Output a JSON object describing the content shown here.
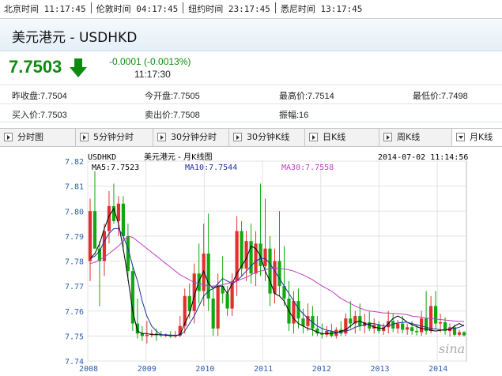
{
  "clocks": [
    {
      "label": "北京时间 11:17:45"
    },
    {
      "label": "伦敦时间 04:17:45"
    },
    {
      "label": "纽约时间 23:17:45"
    },
    {
      "label": "悉尼时间 13:17:45"
    }
  ],
  "header": {
    "title": "美元港元 - USDHKD"
  },
  "quote": {
    "price": "7.7503",
    "change": "-0.0001 (-0.0013%)",
    "time": "11:17:30",
    "arrow_icon": "down-arrow-icon",
    "color": "#0f8a10"
  },
  "stats": {
    "prev_close": "昨收盘:7.7504",
    "open": "今开盘:7.7505",
    "high": "最高价:7.7514",
    "low": "最低价:7.7498",
    "bid": "买入价:7.7503",
    "ask": "卖出价:7.7508",
    "amplitude": "振幅:16"
  },
  "tabs": [
    {
      "label": "分时图"
    },
    {
      "label": "5分钟分时"
    },
    {
      "label": "30分钟分时"
    },
    {
      "label": "30分钟K线"
    },
    {
      "label": "日K线"
    },
    {
      "label": "周K线"
    },
    {
      "label": "月K线",
      "active": true
    }
  ],
  "chart_header": {
    "symbol": "USDHKD",
    "title": "美元港元 - 月K线图",
    "datetime": "2014-07-02 11:14:56",
    "ma5": "MA5:7.7523",
    "ma10": "MA10:7.7544",
    "ma30": "MA30:7.7558",
    "watermark": "sina"
  },
  "colors": {
    "up": "#e03030",
    "down": "#10a810",
    "ma5": "#000000",
    "ma10": "#1f2f9a",
    "ma30": "#c040c0"
  },
  "chart_data": {
    "type": "candlestick",
    "title": "美元港元 - 月K线图",
    "ylim": [
      7.74,
      7.82
    ],
    "yticks": [
      "7.82",
      "7.81",
      "7.80",
      "7.79",
      "7.78",
      "7.77",
      "7.76",
      "7.75",
      "7.74"
    ],
    "xticks": [
      {
        "label": "2008",
        "t": 2008.0
      },
      {
        "label": "2009",
        "t": 2009.0
      },
      {
        "label": "2010",
        "t": 2010.0
      },
      {
        "label": "2011",
        "t": 2011.0
      },
      {
        "label": "2012",
        "t": 2012.0
      },
      {
        "label": "2013",
        "t": 2013.0
      },
      {
        "label": "2014",
        "t": 2014.0
      }
    ],
    "xlim": [
      2008.0,
      2014.5
    ],
    "series": [
      {
        "name": "MA5",
        "values": [
          7.781,
          7.783,
          7.787,
          7.793,
          7.798,
          7.801,
          7.795,
          7.785,
          7.773,
          7.76,
          7.752,
          7.751,
          7.751,
          7.7505,
          7.7505,
          7.7505,
          7.7503,
          7.7502,
          7.7502,
          7.7505,
          7.755,
          7.759,
          7.766,
          7.772,
          7.776,
          7.771,
          7.769,
          7.77,
          7.77,
          7.767,
          7.771,
          7.775,
          7.778,
          7.781,
          7.786,
          7.785,
          7.782,
          7.776,
          7.772,
          7.767,
          7.766,
          7.764,
          7.76,
          7.757,
          7.755,
          7.754,
          7.753,
          7.7525,
          7.7515,
          7.751,
          7.751,
          7.751,
          7.7513,
          7.752,
          7.7525,
          7.754,
          7.7555,
          7.756,
          7.755,
          7.7545,
          7.7535,
          7.7532,
          7.753,
          7.755,
          7.757,
          7.758,
          7.757,
          7.7555,
          7.7545,
          7.7538,
          7.753,
          7.7528,
          7.7523,
          7.752,
          7.7523,
          7.7525,
          7.7525,
          7.754,
          7.755,
          7.754
        ]
      },
      {
        "name": "MA10",
        "values": [
          7.781,
          7.782,
          7.784,
          7.788,
          7.791,
          7.793,
          7.793,
          7.79,
          7.785,
          7.778,
          7.772,
          7.764,
          7.758,
          7.754,
          7.752,
          7.7505,
          7.7505,
          7.7503,
          7.7503,
          7.7503,
          7.752,
          7.755,
          7.758,
          7.762,
          7.766,
          7.768,
          7.769,
          7.771,
          7.773,
          7.772,
          7.771,
          7.772,
          7.774,
          7.776,
          7.778,
          7.78,
          7.781,
          7.781,
          7.779,
          7.776,
          7.773,
          7.77,
          7.767,
          7.764,
          7.761,
          7.759,
          7.757,
          7.7555,
          7.754,
          7.753,
          7.7523,
          7.752,
          7.7515,
          7.7515,
          7.752,
          7.7525,
          7.7535,
          7.754,
          7.7545,
          7.755,
          7.755,
          7.7545,
          7.754,
          7.754,
          7.7548,
          7.7552,
          7.7555,
          7.7555,
          7.755,
          7.7545,
          7.754,
          7.7535,
          7.753,
          7.7528,
          7.7525,
          7.7525,
          7.7528,
          7.753,
          7.7535,
          7.7544
        ]
      },
      {
        "name": "MA30",
        "values": [
          7.779,
          7.7795,
          7.7805,
          7.7815,
          7.783,
          7.7845,
          7.786,
          7.788,
          7.79,
          7.7895,
          7.788,
          7.7865,
          7.785,
          7.7835,
          7.782,
          7.7805,
          7.779,
          7.7775,
          7.776,
          7.7745,
          7.7735,
          7.7725,
          7.7715,
          7.771,
          7.7705,
          7.77,
          7.77,
          7.7702,
          7.7705,
          7.771,
          7.7715,
          7.772,
          7.7728,
          7.7735,
          7.7745,
          7.7755,
          7.776,
          7.7765,
          7.777,
          7.7772,
          7.777,
          7.7768,
          7.7765,
          7.776,
          7.7752,
          7.7745,
          7.7735,
          7.7725,
          7.7712,
          7.77,
          7.769,
          7.768,
          7.7665,
          7.765,
          7.764,
          7.763,
          7.762,
          7.7612,
          7.7605,
          7.76,
          7.7598,
          7.7595,
          7.7592,
          7.7592,
          7.759,
          7.759,
          7.7588,
          7.7585,
          7.758,
          7.7578,
          7.7575,
          7.7572,
          7.757,
          7.7568,
          7.7566,
          7.7564,
          7.7562,
          7.756,
          7.7559,
          7.7558
        ]
      }
    ],
    "candles": [
      {
        "o": 7.78,
        "h": 7.805,
        "l": 7.772,
        "c": 7.8
      },
      {
        "o": 7.8,
        "h": 7.816,
        "l": 7.79,
        "c": 7.785
      },
      {
        "o": 7.785,
        "h": 7.788,
        "l": 7.762,
        "c": 7.78
      },
      {
        "o": 7.78,
        "h": 7.795,
        "l": 7.774,
        "c": 7.792
      },
      {
        "o": 7.792,
        "h": 7.808,
        "l": 7.787,
        "c": 7.802
      },
      {
        "o": 7.802,
        "h": 7.811,
        "l": 7.795,
        "c": 7.796
      },
      {
        "o": 7.796,
        "h": 7.806,
        "l": 7.79,
        "c": 7.803
      },
      {
        "o": 7.803,
        "h": 7.806,
        "l": 7.784,
        "c": 7.79
      },
      {
        "o": 7.79,
        "h": 7.795,
        "l": 7.772,
        "c": 7.776
      },
      {
        "o": 7.776,
        "h": 7.778,
        "l": 7.752,
        "c": 7.755
      },
      {
        "o": 7.755,
        "h": 7.765,
        "l": 7.749,
        "c": 7.751
      },
      {
        "o": 7.751,
        "h": 7.754,
        "l": 7.748,
        "c": 7.75
      },
      {
        "o": 7.75,
        "h": 7.756,
        "l": 7.747,
        "c": 7.7505
      },
      {
        "o": 7.7505,
        "h": 7.7525,
        "l": 7.7495,
        "c": 7.751
      },
      {
        "o": 7.751,
        "h": 7.753,
        "l": 7.748,
        "c": 7.7505
      },
      {
        "o": 7.7505,
        "h": 7.752,
        "l": 7.7495,
        "c": 7.7502
      },
      {
        "o": 7.7502,
        "h": 7.751,
        "l": 7.7495,
        "c": 7.7505
      },
      {
        "o": 7.7505,
        "h": 7.752,
        "l": 7.7492,
        "c": 7.7498
      },
      {
        "o": 7.7498,
        "h": 7.752,
        "l": 7.7492,
        "c": 7.7502
      },
      {
        "o": 7.7502,
        "h": 7.758,
        "l": 7.7495,
        "c": 7.754
      },
      {
        "o": 7.754,
        "h": 7.769,
        "l": 7.751,
        "c": 7.766
      },
      {
        "o": 7.766,
        "h": 7.771,
        "l": 7.757,
        "c": 7.76
      },
      {
        "o": 7.76,
        "h": 7.779,
        "l": 7.755,
        "c": 7.775
      },
      {
        "o": 7.775,
        "h": 7.787,
        "l": 7.763,
        "c": 7.768
      },
      {
        "o": 7.768,
        "h": 7.795,
        "l": 7.762,
        "c": 7.783
      },
      {
        "o": 7.783,
        "h": 7.799,
        "l": 7.76,
        "c": 7.765
      },
      {
        "o": 7.765,
        "h": 7.77,
        "l": 7.75,
        "c": 7.753
      },
      {
        "o": 7.753,
        "h": 7.775,
        "l": 7.75,
        "c": 7.77
      },
      {
        "o": 7.77,
        "h": 7.782,
        "l": 7.763,
        "c": 7.767
      },
      {
        "o": 7.767,
        "h": 7.77,
        "l": 7.758,
        "c": 7.761
      },
      {
        "o": 7.761,
        "h": 7.775,
        "l": 7.758,
        "c": 7.772
      },
      {
        "o": 7.772,
        "h": 7.798,
        "l": 7.766,
        "c": 7.792
      },
      {
        "o": 7.792,
        "h": 7.796,
        "l": 7.774,
        "c": 7.777
      },
      {
        "o": 7.777,
        "h": 7.792,
        "l": 7.772,
        "c": 7.788
      },
      {
        "o": 7.788,
        "h": 7.795,
        "l": 7.771,
        "c": 7.775
      },
      {
        "o": 7.775,
        "h": 7.792,
        "l": 7.77,
        "c": 7.787
      },
      {
        "o": 7.787,
        "h": 7.811,
        "l": 7.774,
        "c": 7.778
      },
      {
        "o": 7.778,
        "h": 7.805,
        "l": 7.772,
        "c": 7.785
      },
      {
        "o": 7.785,
        "h": 7.79,
        "l": 7.762,
        "c": 7.767
      },
      {
        "o": 7.767,
        "h": 7.785,
        "l": 7.763,
        "c": 7.78
      },
      {
        "o": 7.78,
        "h": 7.8,
        "l": 7.766,
        "c": 7.77
      },
      {
        "o": 7.77,
        "h": 7.786,
        "l": 7.762,
        "c": 7.765
      },
      {
        "o": 7.765,
        "h": 7.772,
        "l": 7.752,
        "c": 7.755
      },
      {
        "o": 7.755,
        "h": 7.768,
        "l": 7.751,
        "c": 7.764
      },
      {
        "o": 7.764,
        "h": 7.769,
        "l": 7.753,
        "c": 7.757
      },
      {
        "o": 7.757,
        "h": 7.761,
        "l": 7.751,
        "c": 7.754
      },
      {
        "o": 7.754,
        "h": 7.763,
        "l": 7.752,
        "c": 7.758
      },
      {
        "o": 7.758,
        "h": 7.762,
        "l": 7.75,
        "c": 7.753
      },
      {
        "o": 7.753,
        "h": 7.758,
        "l": 7.75,
        "c": 7.751
      },
      {
        "o": 7.751,
        "h": 7.755,
        "l": 7.749,
        "c": 7.7505
      },
      {
        "o": 7.7505,
        "h": 7.754,
        "l": 7.7495,
        "c": 7.752
      },
      {
        "o": 7.752,
        "h": 7.755,
        "l": 7.7495,
        "c": 7.75
      },
      {
        "o": 7.75,
        "h": 7.7535,
        "l": 7.749,
        "c": 7.7525
      },
      {
        "o": 7.7525,
        "h": 7.756,
        "l": 7.75,
        "c": 7.751
      },
      {
        "o": 7.751,
        "h": 7.759,
        "l": 7.75,
        "c": 7.757
      },
      {
        "o": 7.757,
        "h": 7.764,
        "l": 7.753,
        "c": 7.755
      },
      {
        "o": 7.755,
        "h": 7.76,
        "l": 7.751,
        "c": 7.758
      },
      {
        "o": 7.758,
        "h": 7.763,
        "l": 7.752,
        "c": 7.754
      },
      {
        "o": 7.754,
        "h": 7.759,
        "l": 7.751,
        "c": 7.7555
      },
      {
        "o": 7.7555,
        "h": 7.76,
        "l": 7.752,
        "c": 7.753
      },
      {
        "o": 7.753,
        "h": 7.757,
        "l": 7.751,
        "c": 7.7545
      },
      {
        "o": 7.7545,
        "h": 7.756,
        "l": 7.751,
        "c": 7.752
      },
      {
        "o": 7.752,
        "h": 7.755,
        "l": 7.7505,
        "c": 7.7535
      },
      {
        "o": 7.7535,
        "h": 7.76,
        "l": 7.751,
        "c": 7.756
      },
      {
        "o": 7.756,
        "h": 7.759,
        "l": 7.7515,
        "c": 7.753
      },
      {
        "o": 7.753,
        "h": 7.7565,
        "l": 7.751,
        "c": 7.755
      },
      {
        "o": 7.755,
        "h": 7.758,
        "l": 7.751,
        "c": 7.7525
      },
      {
        "o": 7.7525,
        "h": 7.755,
        "l": 7.7505,
        "c": 7.7535
      },
      {
        "o": 7.7535,
        "h": 7.756,
        "l": 7.7505,
        "c": 7.752
      },
      {
        "o": 7.752,
        "h": 7.7545,
        "l": 7.7502,
        "c": 7.7515
      },
      {
        "o": 7.7515,
        "h": 7.76,
        "l": 7.75,
        "c": 7.757
      },
      {
        "o": 7.757,
        "h": 7.768,
        "l": 7.7505,
        "c": 7.752
      },
      {
        "o": 7.752,
        "h": 7.766,
        "l": 7.751,
        "c": 7.762
      },
      {
        "o": 7.762,
        "h": 7.768,
        "l": 7.753,
        "c": 7.755
      },
      {
        "o": 7.755,
        "h": 7.759,
        "l": 7.7515,
        "c": 7.7555
      },
      {
        "o": 7.7555,
        "h": 7.7575,
        "l": 7.7505,
        "c": 7.752
      },
      {
        "o": 7.752,
        "h": 7.755,
        "l": 7.7498,
        "c": 7.7535
      },
      {
        "o": 7.7535,
        "h": 7.7545,
        "l": 7.7498,
        "c": 7.7505
      },
      {
        "o": 7.7505,
        "h": 7.7525,
        "l": 7.7498,
        "c": 7.7515
      },
      {
        "o": 7.7515,
        "h": 7.752,
        "l": 7.7498,
        "c": 7.7503
      }
    ]
  }
}
